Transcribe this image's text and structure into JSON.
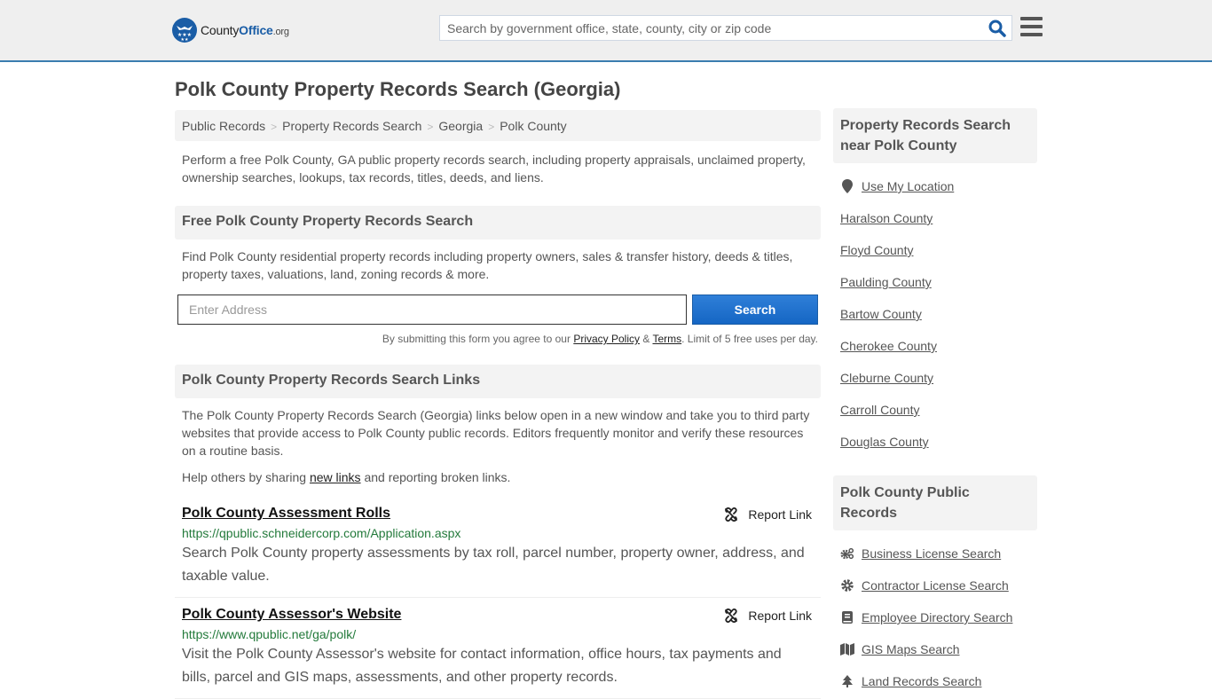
{
  "header": {
    "logo": {
      "county": "County",
      "office": "Office",
      "org": ".org"
    },
    "search_placeholder": "Search by government office, state, county, city or zip code",
    "brand_color": "#1a5da6",
    "accent_border": "#3b7daf"
  },
  "page_title": "Polk County Property Records Search (Georgia)",
  "breadcrumb": [
    "Public Records",
    "Property Records Search",
    "Georgia",
    "Polk County"
  ],
  "intro": "Perform a free Polk County, GA public property records search, including property appraisals, unclaimed property, ownership searches, lookups, tax records, titles, deeds, and liens.",
  "free_search": {
    "heading": "Free Polk County Property Records Search",
    "description": "Find Polk County residential property records including property owners, sales & transfer history, deeds & titles, property taxes, valuations, land, zoning records & more.",
    "input_placeholder": "Enter Address",
    "button_label": "Search",
    "terms_prefix": "By submitting this form you agree to our ",
    "privacy_label": "Privacy Policy",
    "amp": " & ",
    "terms_label": "Terms",
    "terms_suffix": ". Limit of 5 free uses per day."
  },
  "links_section": {
    "heading": "Polk County Property Records Search Links",
    "description": "The Polk County Property Records Search (Georgia) links below open in a new window and take you to third party websites that provide access to Polk County public records. Editors frequently monitor and verify these resources on a routine basis.",
    "help_prefix": "Help others by sharing ",
    "help_link": "new links",
    "help_suffix": " and reporting broken links.",
    "report_label": "Report Link",
    "items": [
      {
        "title": "Polk County Assessment Rolls",
        "url": "https://qpublic.schneidercorp.com/Application.aspx",
        "description": "Search Polk County property assessments by tax roll, parcel number, property owner, address, and taxable value."
      },
      {
        "title": "Polk County Assessor's Website",
        "url": "https://www.qpublic.net/ga/polk/",
        "description": "Visit the Polk County Assessor's website for contact information, office hours, tax payments and bills, parcel and GIS maps, assessments, and other property records."
      }
    ]
  },
  "sidebar": {
    "nearby_heading": "Property Records Search near Polk County",
    "use_location": "Use My Location",
    "nearby": [
      "Haralson County",
      "Floyd County",
      "Paulding County",
      "Bartow County",
      "Cherokee County",
      "Cleburne County",
      "Carroll County",
      "Douglas County"
    ],
    "public_records_heading": "Polk County Public Records",
    "public_records": [
      {
        "label": "Business License Search",
        "icon": "gears-icon"
      },
      {
        "label": "Contractor License Search",
        "icon": "gear-icon"
      },
      {
        "label": "Employee Directory Search",
        "icon": "book-icon"
      },
      {
        "label": "GIS Maps Search",
        "icon": "map-icon"
      },
      {
        "label": "Land Records Search",
        "icon": "tree-icon"
      }
    ]
  }
}
